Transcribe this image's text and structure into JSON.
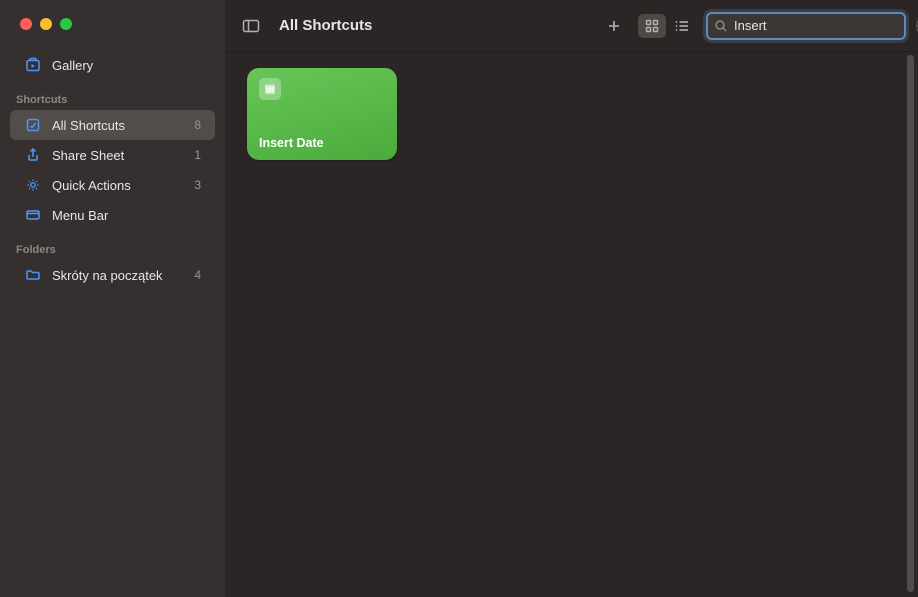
{
  "header": {
    "title": "All Shortcuts"
  },
  "sidebar": {
    "gallery_label": "Gallery",
    "section_shortcuts": "Shortcuts",
    "section_folders": "Folders",
    "items": [
      {
        "label": "All Shortcuts",
        "count": "8"
      },
      {
        "label": "Share Sheet",
        "count": "1"
      },
      {
        "label": "Quick Actions",
        "count": "3"
      },
      {
        "label": "Menu Bar",
        "count": ""
      }
    ],
    "folders": [
      {
        "label": "Skróty na początek",
        "count": "4"
      }
    ]
  },
  "search": {
    "value": "Insert",
    "placeholder": "Search"
  },
  "shortcuts": [
    {
      "name": "Insert Date",
      "color": "#5cbf4d"
    }
  ]
}
